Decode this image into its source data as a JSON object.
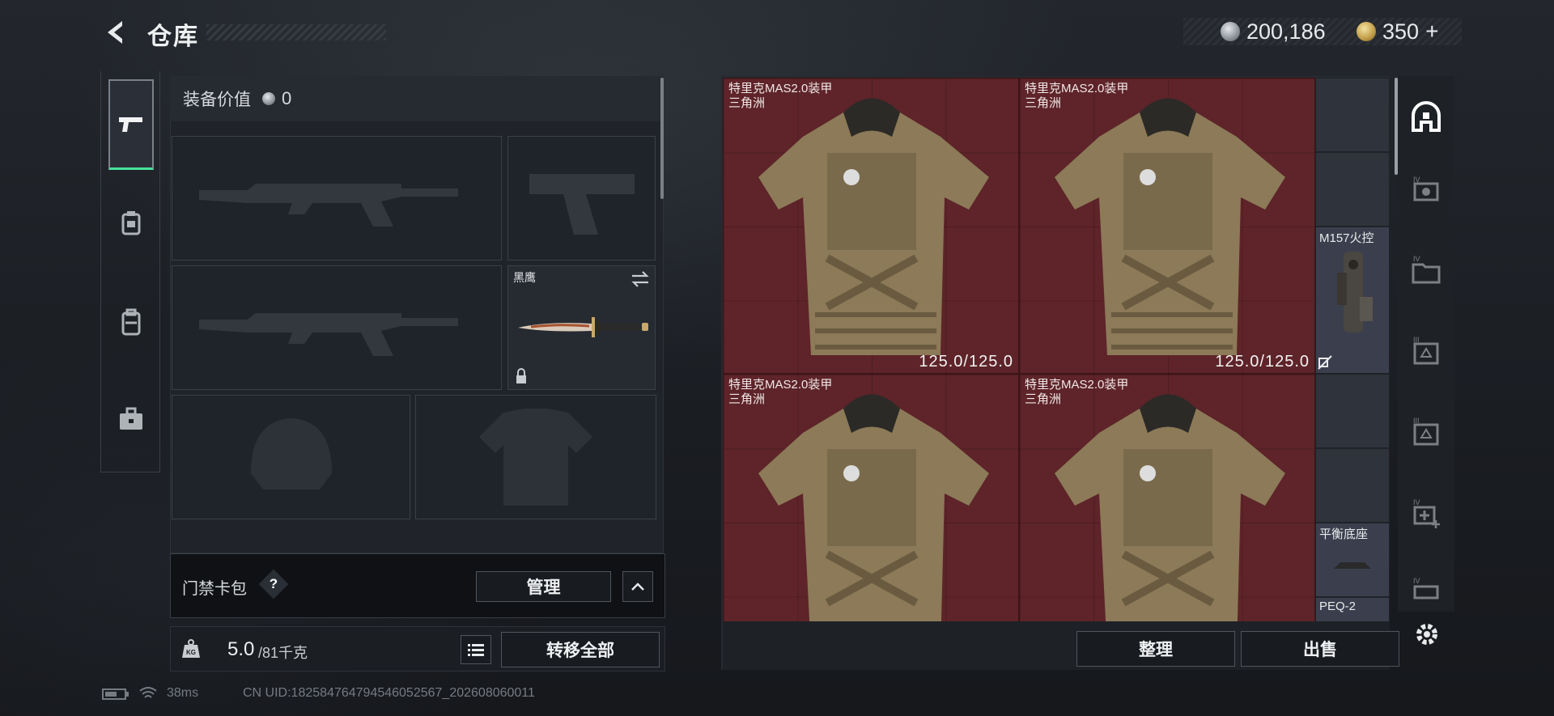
{
  "header": {
    "title": "仓库",
    "currency_silver": "200,186",
    "currency_gold": "350",
    "currency_plus": "+"
  },
  "sidebar": {
    "tabs": [
      {
        "icon": "pistol-icon",
        "active": true
      },
      {
        "icon": "backpack-vest-icon",
        "active": false
      },
      {
        "icon": "backpack-icon",
        "active": false
      },
      {
        "icon": "briefcase-icon",
        "active": false
      }
    ]
  },
  "loadout": {
    "equip_value_label": "装备价值",
    "equip_value": "0",
    "melee_name": "黑鹰",
    "keycard_label": "门禁卡包",
    "keycard_help": "?",
    "manage_button": "管理",
    "weight_current": "5.0",
    "weight_max": "/81千克",
    "transfer_all_button": "转移全部"
  },
  "inventory": {
    "items": [
      {
        "name": "特里克MAS2.0装甲",
        "sub": "三角洲",
        "durability": "125.0/125.0"
      },
      {
        "name": "特里克MAS2.0装甲",
        "sub": "三角洲",
        "durability": "125.0/125.0"
      },
      {
        "name": "特里克MAS2.0装甲",
        "sub": "三角洲",
        "durability": ""
      },
      {
        "name": "特里克MAS2.0装甲",
        "sub": "三角洲",
        "durability": ""
      }
    ],
    "mods": [
      {
        "name": "M157火控"
      },
      {
        "name": "平衡底座"
      },
      {
        "name": "PEQ-2"
      }
    ],
    "organize_button": "整理",
    "sell_button": "出售"
  },
  "filter_icons": [
    "home-filter-icon",
    "scope-filter-icon",
    "folder-filter-icon",
    "armor-filter-icon",
    "helmet-filter-icon",
    "medkit-filter-icon",
    "vehicle-filter-icon"
  ],
  "status": {
    "ping": "38ms",
    "uid": "CN UID:18258476479454605256​7_202608060011"
  },
  "colors": {
    "accent_green": "#47e29a",
    "item_bg_red": "#5e2429",
    "mod_bg": "#3b3f4d"
  }
}
